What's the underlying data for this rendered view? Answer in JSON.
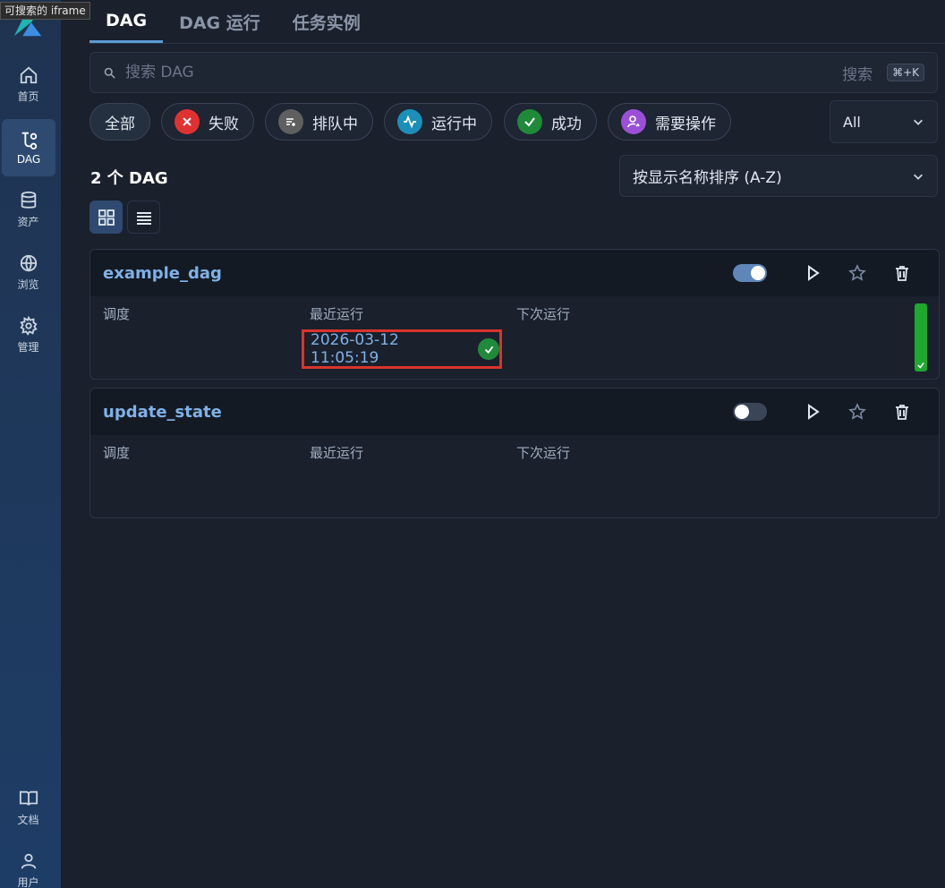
{
  "iframe_badge": "可搜索的 iframe",
  "sidebar": {
    "items": [
      {
        "label": "首页",
        "icon": "home-icon"
      },
      {
        "label": "DAG",
        "icon": "dag-icon"
      },
      {
        "label": "资产",
        "icon": "database-icon"
      },
      {
        "label": "浏览",
        "icon": "globe-icon"
      },
      {
        "label": "管理",
        "icon": "gear-icon"
      }
    ],
    "bottom_items": [
      {
        "label": "文档",
        "icon": "book-icon"
      },
      {
        "label": "用户",
        "icon": "user-icon"
      }
    ]
  },
  "tabs": [
    "DAG",
    "DAG 运行",
    "任务实例"
  ],
  "search": {
    "placeholder": "搜索 DAG",
    "label": "搜索",
    "shortcut": "⌘+K"
  },
  "filters": [
    {
      "label": "全部"
    },
    {
      "label": "失败",
      "color": "#e03131"
    },
    {
      "label": "排队中",
      "color": "#5f5f5f"
    },
    {
      "label": "运行中",
      "color": "#1c8fb8"
    },
    {
      "label": "成功",
      "color": "#1f8a3a"
    },
    {
      "label": "需要操作",
      "color": "#9b4fd6"
    }
  ],
  "state_select": "All",
  "dag_count": "2 个 DAG",
  "sort": "按显示名称排序 (A-Z)",
  "columns": {
    "schedule": "调度",
    "last_run": "最近运行",
    "next_run": "下次运行"
  },
  "dags": [
    {
      "name": "example_dag",
      "paused": false,
      "last_run": "2026-03-12 11:05:19",
      "last_run_state": "success"
    },
    {
      "name": "update_state",
      "paused": true,
      "last_run": "",
      "last_run_state": ""
    }
  ]
}
